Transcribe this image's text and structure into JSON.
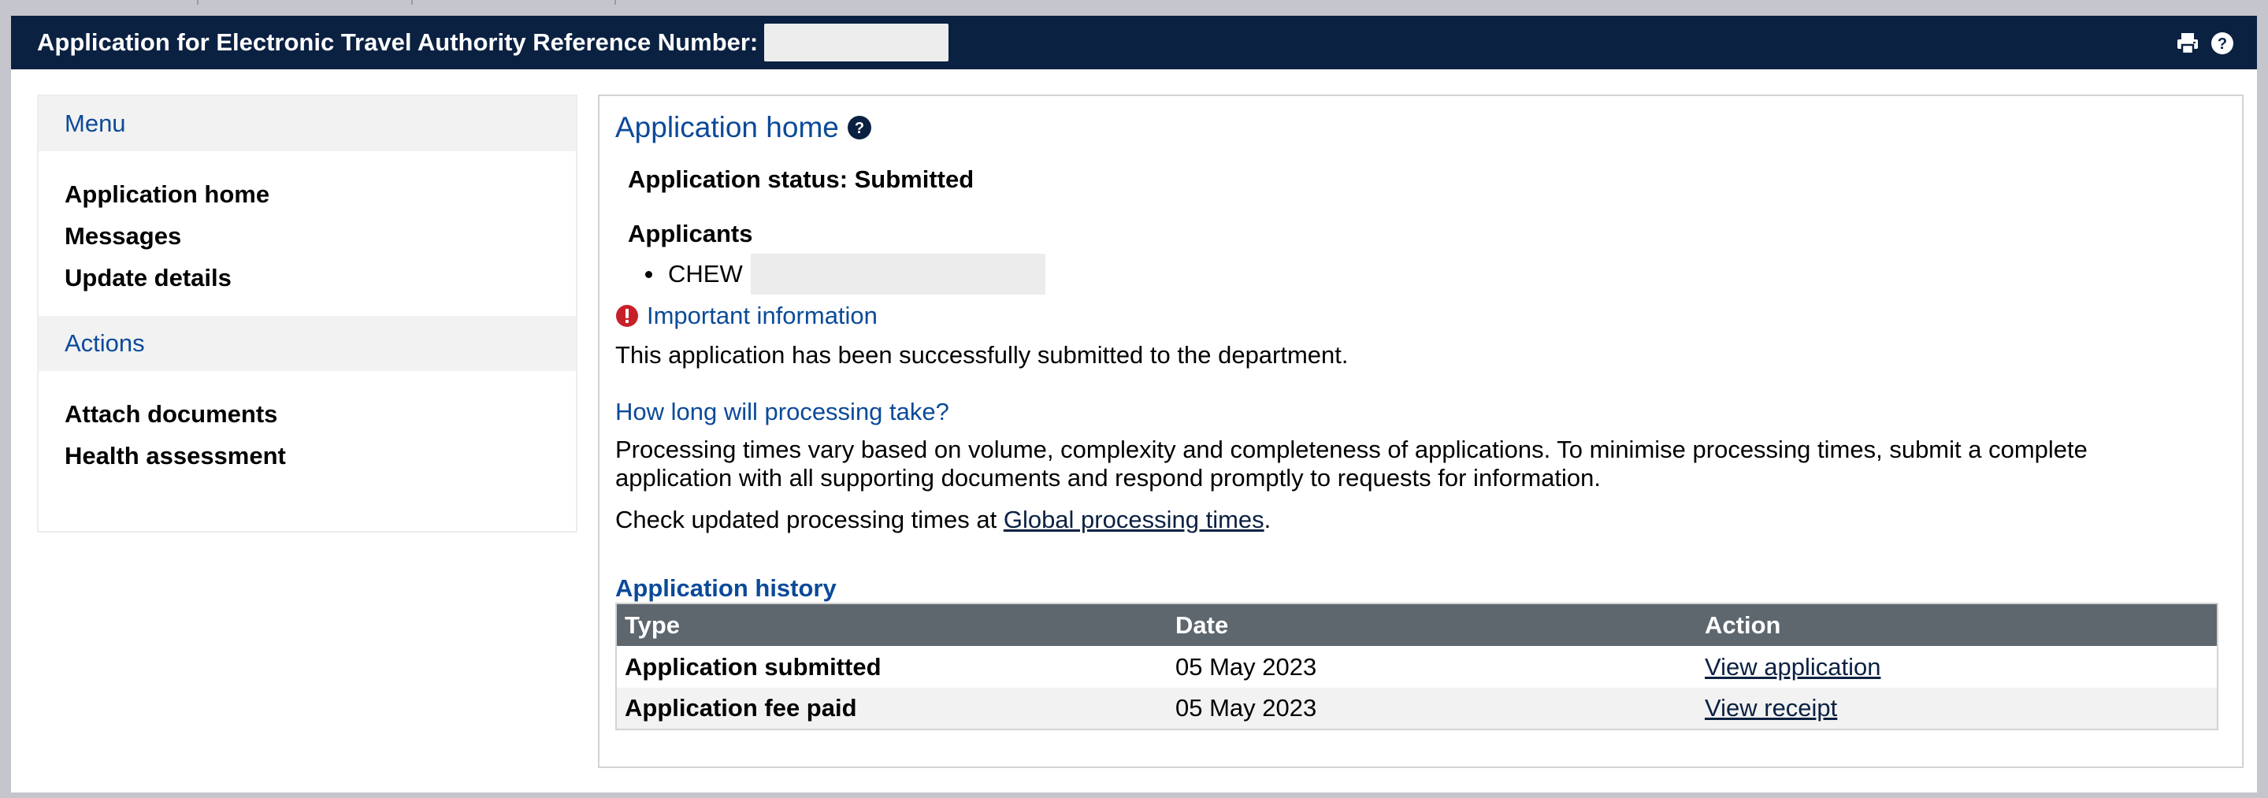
{
  "header": {
    "title": "Application for Electronic Travel Authority Reference Number:",
    "reference_number": "",
    "print_icon": "print-icon",
    "help_icon": "help-icon"
  },
  "sidebar": {
    "menu_heading": "Menu",
    "menu_items": [
      {
        "label": "Application home"
      },
      {
        "label": "Messages"
      },
      {
        "label": "Update details"
      }
    ],
    "actions_heading": "Actions",
    "action_items": [
      {
        "label": "Attach documents"
      },
      {
        "label": "Health assessment"
      }
    ]
  },
  "main": {
    "page_title": "Application home",
    "status_text": "Application status: Submitted",
    "applicants_heading": "Applicants",
    "applicants": [
      {
        "name": "CHEW"
      }
    ],
    "important_info_label": "Important information",
    "submitted_message": "This application has been successfully submitted to the department.",
    "processing_heading": "How long will processing take?",
    "processing_line1": "Processing times vary based on volume, complexity and completeness of applications. To minimise processing times, submit a complete",
    "processing_line2": "application with all supporting documents and respond promptly to requests for information.",
    "check_prefix": "Check updated processing times at ",
    "check_link": "Global processing times",
    "check_suffix": ".",
    "history_heading": "Application history",
    "history": {
      "columns": [
        "Type",
        "Date",
        "Action"
      ],
      "rows": [
        {
          "type": "Application submitted",
          "date": "05 May 2023",
          "action": "View application"
        },
        {
          "type": "Application fee paid",
          "date": "05 May 2023",
          "action": "View receipt"
        }
      ]
    }
  },
  "colors": {
    "header_bg": "#0b2142",
    "link_blue": "#0b4a99",
    "table_header_bg": "#5e676e",
    "alert_red": "#c8202a"
  }
}
